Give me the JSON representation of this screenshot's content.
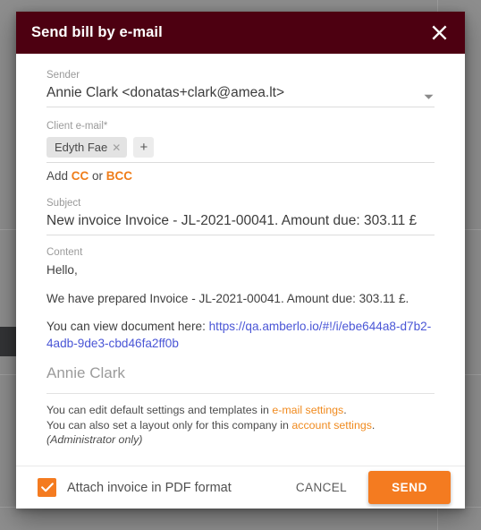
{
  "dialog": {
    "title": "Send bill by e-mail",
    "close_icon": "close-icon",
    "header_color": "#4d0011"
  },
  "sender": {
    "label": "Sender",
    "value": "Annie Clark <donatas+clark@amea.lt>",
    "caret_icon": "chevron-down-icon"
  },
  "client_email": {
    "label": "Client e-mail*",
    "chips": [
      {
        "name": "Edyth Fae",
        "remove_icon": "close-icon"
      }
    ],
    "add_label": "+",
    "cc_prefix": "Add ",
    "cc_label": "CC",
    "cc_middle": " or ",
    "bcc_label": "BCC"
  },
  "subject": {
    "label": "Subject",
    "value": "New invoice Invoice - JL-2021-00041. Amount due: 303.11 £"
  },
  "content": {
    "label": "Content",
    "greeting": "Hello,",
    "body_line": "We have prepared Invoice - JL-2021-00041. Amount due: 303.11 £.",
    "link_prefix": "You can view document here: ",
    "link_url": "https://qa.amberlo.io/#!/i/ebe644a8-d7b2-4adb-9de3-cbd46fa2ff0b",
    "signature": "Annie Clark"
  },
  "note": {
    "line1_prefix": "You can edit default settings and templates in ",
    "line1_link": "e-mail settings",
    "line1_suffix": ".",
    "line2_prefix": "You can also set a layout only for this company in ",
    "line2_link": "account settings",
    "line2_suffix": ".",
    "line3": "(Administrator only)"
  },
  "footer": {
    "attach_label": "Attach invoice in PDF format",
    "attach_checked": true,
    "check_icon": "check-icon",
    "cancel_label": "CANCEL",
    "send_label": "SEND",
    "accent_color": "#f47b20"
  }
}
